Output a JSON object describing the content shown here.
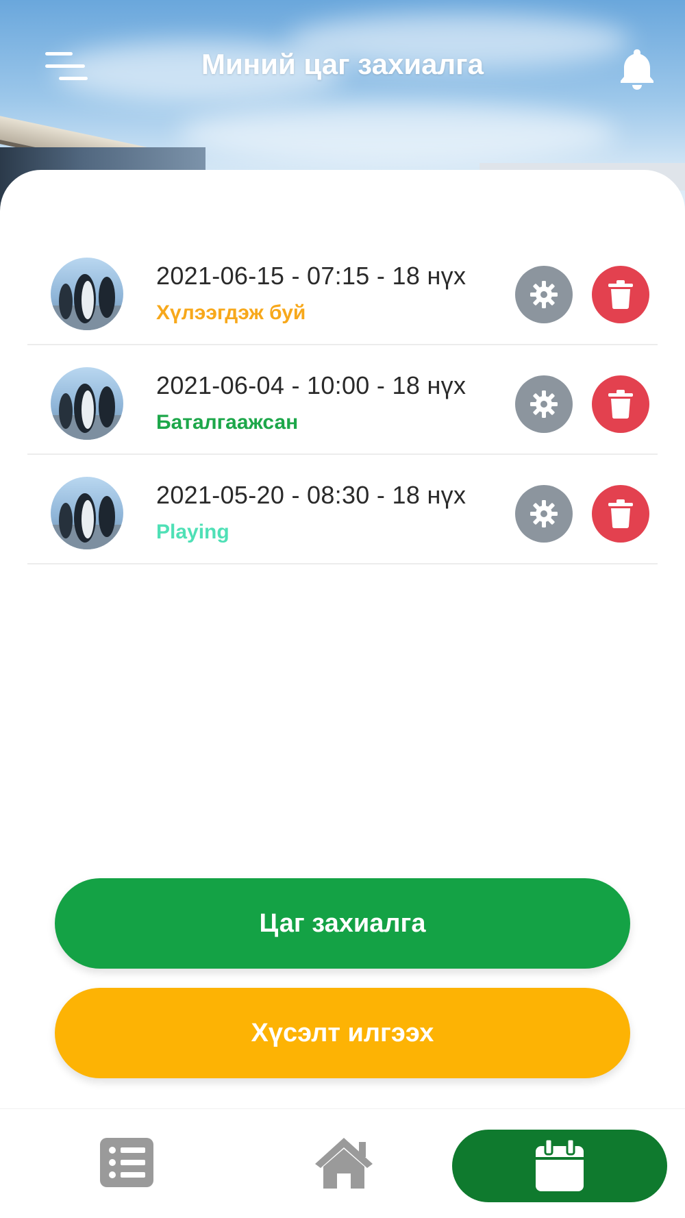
{
  "header": {
    "title": "Миний цаг захиалга",
    "menu_icon": "hamburger-menu-icon",
    "notification_icon": "bell-icon"
  },
  "bookings": [
    {
      "details": "2021-06-15 - 07:15 - 18 нүх",
      "status": "Хүлээгдэж буй",
      "status_color": "#f7a81b"
    },
    {
      "details": "2021-06-04 - 10:00 - 18 нүх",
      "status": "Баталгаажсан",
      "status_color": "#1da74a"
    },
    {
      "details": "2021-05-20 - 08:30 - 18 нүх",
      "status": "Playing",
      "status_color": "#4fe0b6"
    }
  ],
  "row_actions": {
    "settings_icon": "gear-icon",
    "delete_icon": "trash-icon"
  },
  "actions": {
    "book_label": "Цаг захиалга",
    "request_label": "Хүсэлт илгээх"
  },
  "bottom_nav": {
    "items": [
      {
        "icon": "list-icon",
        "active": false
      },
      {
        "icon": "home-icon",
        "active": false
      },
      {
        "icon": "calendar-icon",
        "active": true
      }
    ]
  },
  "colors": {
    "primary_green": "#14a245",
    "accent_yellow": "#fdb304",
    "nav_active": "#0f7a2e",
    "settings_gray": "#8c959e",
    "delete_red": "#e3414f"
  }
}
